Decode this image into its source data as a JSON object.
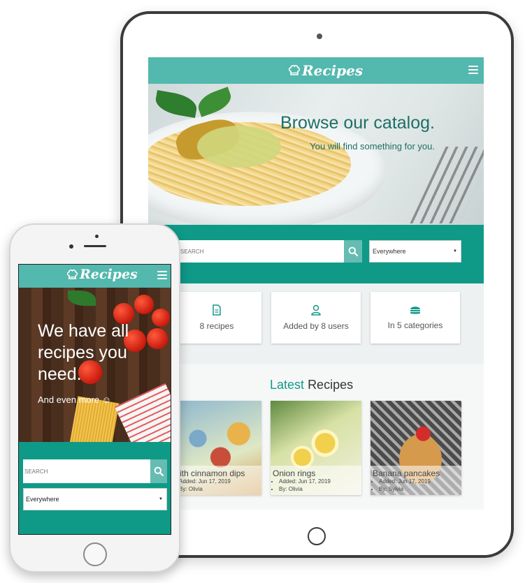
{
  "tablet": {
    "brand": "Recipes",
    "hero": {
      "title": "Browse our catalog.",
      "subtitle": "You will find something for you."
    },
    "search": {
      "placeholder": "SEARCH",
      "select_value": "Everywhere"
    },
    "stats": [
      {
        "icon": "document-icon",
        "label": "8 recipes"
      },
      {
        "icon": "user-icon",
        "label": "Added by 8 users"
      },
      {
        "icon": "burger-icon",
        "label": "In 5 categories"
      }
    ],
    "latest": {
      "title_accent": "Latest",
      "title_rest": "Recipes"
    },
    "recipes": [
      {
        "name": "Fruits with cinnamon dips",
        "added": "Added: Jun 17, 2019",
        "by": "By: Olivia"
      },
      {
        "name": "Onion rings",
        "added": "Added: Jun 17, 2019",
        "by": "By: Olivia"
      },
      {
        "name": "Banana pancakes",
        "added": "Added: Jun 17, 2019",
        "by": "By: Sylvia"
      }
    ]
  },
  "phone": {
    "brand": "Recipes",
    "hero": {
      "title": "We have all recipes you need.",
      "subtitle": "And even more ☺"
    },
    "search": {
      "placeholder": "SEARCH",
      "select_value": "Everywhere"
    }
  },
  "colors": {
    "primary": "#0f9a88",
    "nav": "#53b8ad",
    "accent_text": "#14998a",
    "button": "#66bcb2"
  }
}
